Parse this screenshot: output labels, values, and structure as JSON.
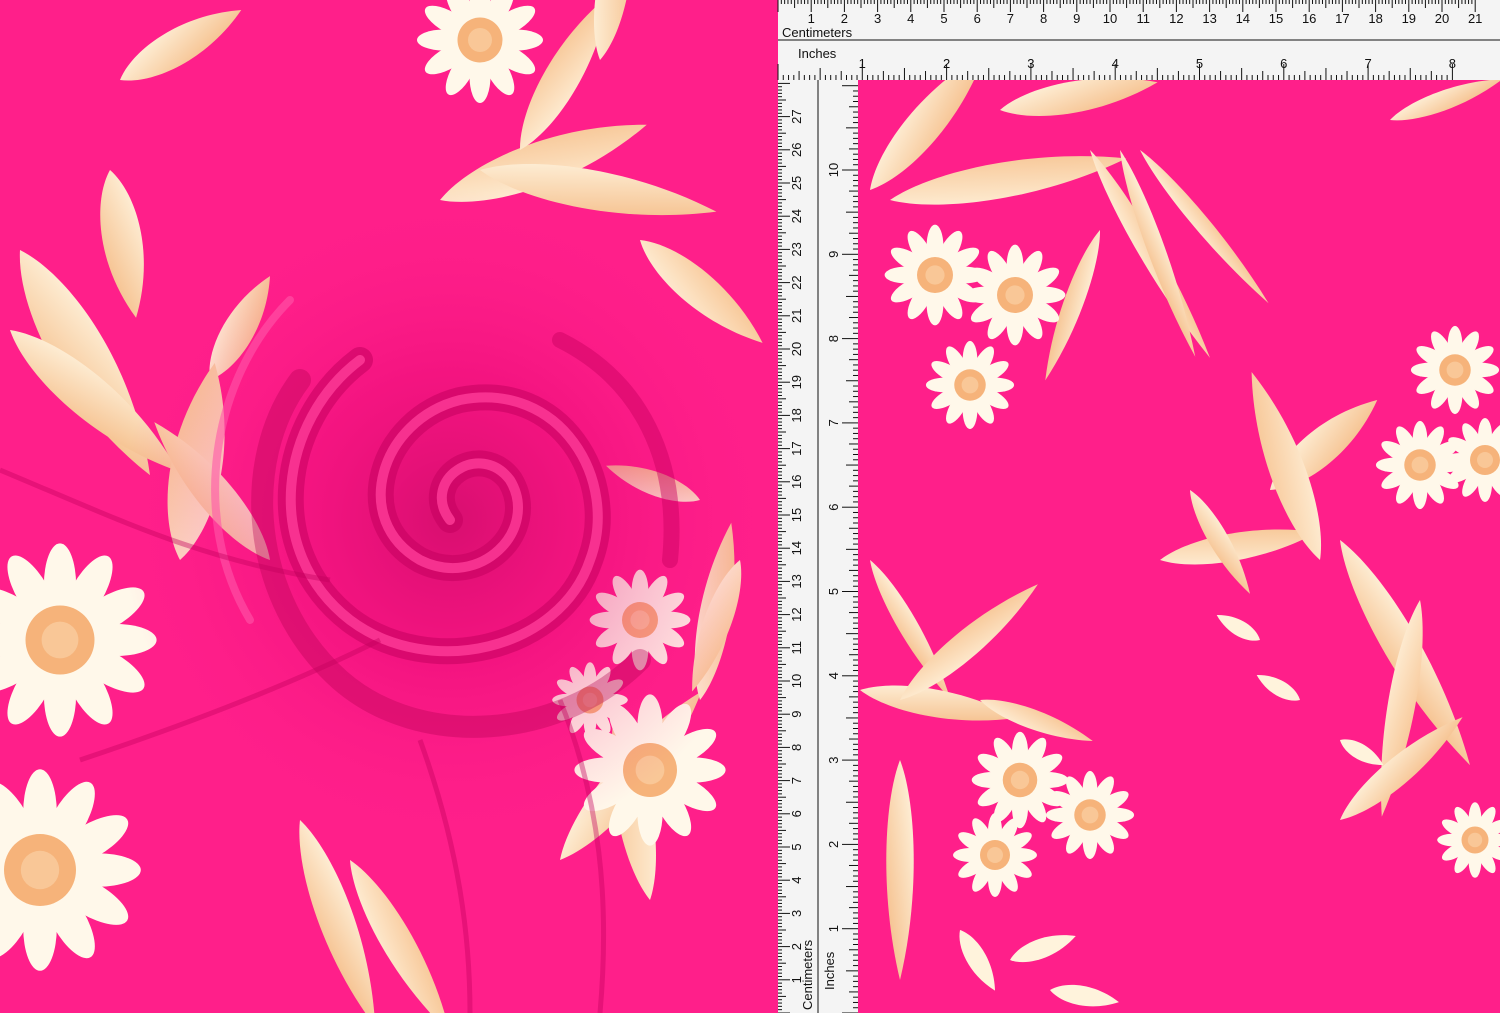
{
  "colors": {
    "fabric_pink": "#ff1f8a",
    "fabric_pink_shadow": "#d9006a",
    "fabric_pink_light": "#ff4aa0",
    "leaf_peach": "#f6c08c",
    "leaf_cream": "#fff3dc",
    "flower_white": "#fff8ea",
    "flower_center": "#f6b37a",
    "ruler_bg": "#f4f4f4",
    "ruler_ink": "#111111"
  },
  "ruler": {
    "top_unit_cm": "Centimeters",
    "top_unit_in": "Inches",
    "left_unit_cm": "Centimeters",
    "left_unit_in": "Inches",
    "top_cm_labels": [
      "1",
      "2",
      "3",
      "4",
      "5",
      "6",
      "7",
      "8",
      "9",
      "10",
      "11",
      "12",
      "13",
      "14",
      "15",
      "16",
      "17",
      "18",
      "19",
      "20",
      "21"
    ],
    "top_in_labels": [
      "1",
      "2",
      "3",
      "4",
      "5",
      "6",
      "7",
      "8"
    ],
    "left_cm_labels": [
      "1",
      "2",
      "3",
      "4",
      "5",
      "6",
      "7",
      "8",
      "9",
      "10",
      "11",
      "12",
      "13",
      "14",
      "15",
      "16",
      "17",
      "18",
      "19",
      "20",
      "21",
      "22",
      "23",
      "24",
      "25",
      "26",
      "27",
      "2"
    ],
    "left_in_labels": [
      "1",
      "2",
      "3",
      "4",
      "5",
      "6",
      "7",
      "8",
      "9",
      "10"
    ]
  },
  "panels": {
    "left": "draped-fabric-swirl",
    "right": "flat-fabric-with-rulers"
  }
}
